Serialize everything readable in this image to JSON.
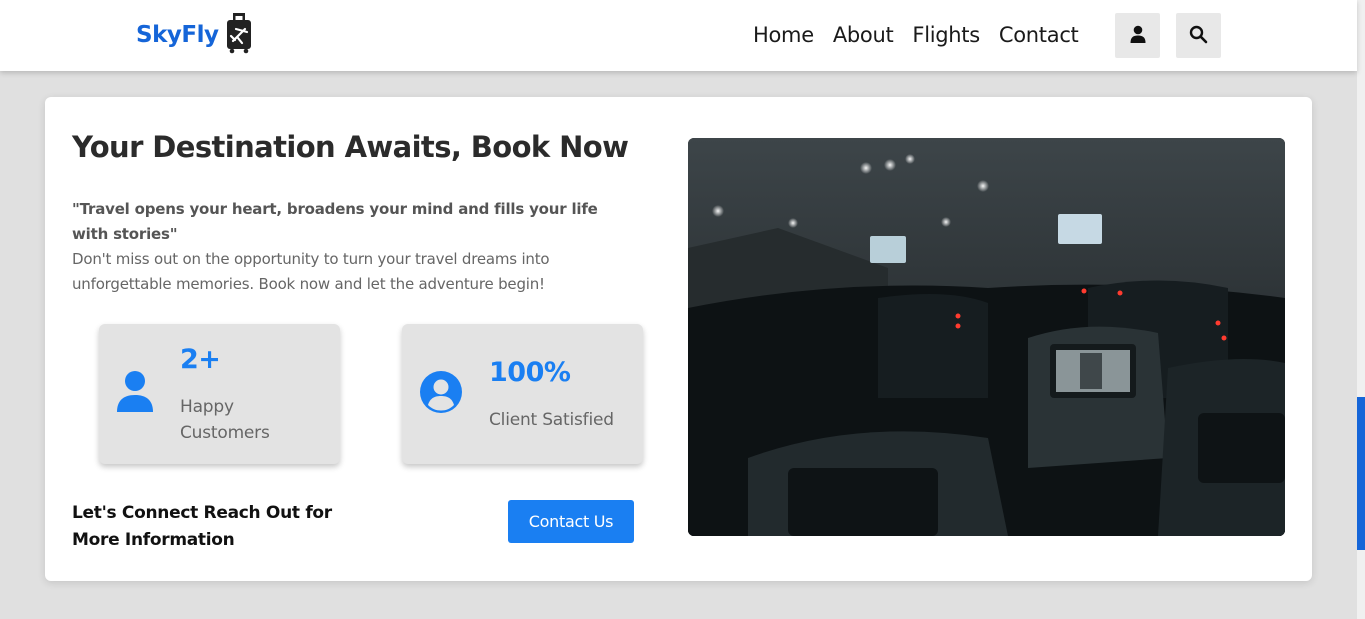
{
  "brand": {
    "name": "SkyFly",
    "accent_color": "#1565d8",
    "logo_icon": "luggage-airplane-icon"
  },
  "nav": {
    "links": [
      "Home",
      "About",
      "Flights",
      "Contact"
    ],
    "user_icon": "user-icon",
    "search_icon": "search-icon"
  },
  "hero": {
    "headline": "Your Destination Awaits, Book Now",
    "quote": "\"Travel opens your heart, broadens your mind and fills your life with stories\"",
    "description": "Don't miss out on the opportunity to turn your travel dreams into unforgettable memories. Book now and let the adventure begin!",
    "image_icon": "airplane-cabin-photo"
  },
  "stats": [
    {
      "value": "2+",
      "label": "Happy Customers",
      "icon": "person-icon"
    },
    {
      "value": "100%",
      "label": "Client Satisfied",
      "icon": "user-circle-icon"
    }
  ],
  "cta": {
    "text": "Let's Connect Reach Out for More Information",
    "button_label": "Contact Us",
    "button_color": "#1a7ff2"
  }
}
